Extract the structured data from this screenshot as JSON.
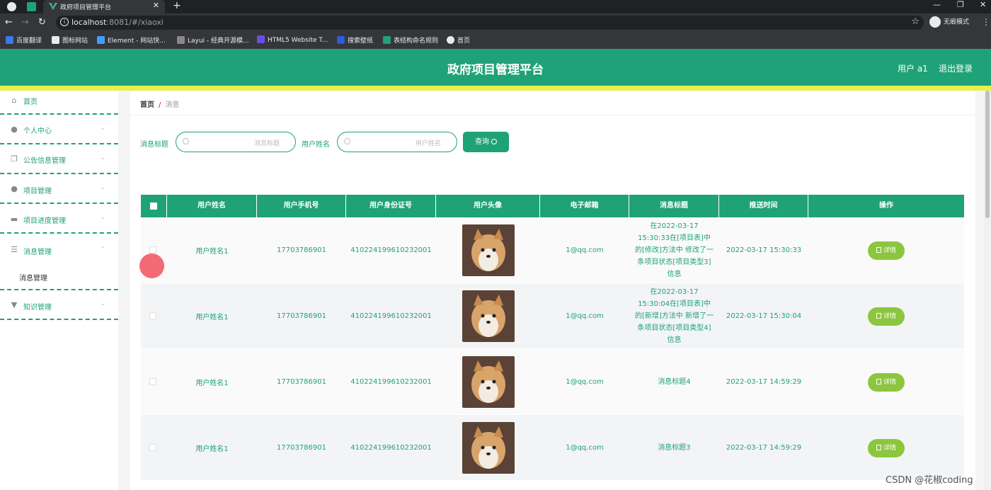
{
  "browser": {
    "tab_title": "政府项目管理平台",
    "tab_close": "✕",
    "new_tab": "+",
    "url_host": "localhost",
    "url_rest": ":8081/#/xiaoxi",
    "incognito_label": "无痕模式",
    "bookmarks": [
      {
        "label": "百度翻译",
        "color": "#3b7be8"
      },
      {
        "label": "图标网站",
        "color": "#333333"
      },
      {
        "label": "Element - 网站快...",
        "color": "#409eff"
      },
      {
        "label": "Layui - 经典开源模...",
        "color": "#888888"
      },
      {
        "label": "HTML5 Website T...",
        "color": "#6a4de2"
      },
      {
        "label": "搜索壁纸",
        "color": "#2f5bd8"
      },
      {
        "label": "表结构命名规则",
        "color": "#1fa277"
      },
      {
        "label": "首页",
        "color": "#e8eaed"
      }
    ]
  },
  "header": {
    "title": "政府项目管理平台",
    "user": "用户 a1",
    "logout": "退出登录"
  },
  "sidebar": {
    "items": [
      {
        "label": "首页",
        "icon": "home-icon",
        "glyph": "⌂"
      },
      {
        "label": "个人中心",
        "icon": "user-icon",
        "glyph": "●"
      },
      {
        "label": "公告信息管理",
        "icon": "copy-icon",
        "glyph": "❐"
      },
      {
        "label": "项目管理",
        "icon": "person-icon",
        "glyph": "●"
      },
      {
        "label": "项目进度管理",
        "icon": "briefcase-icon",
        "glyph": "▬"
      },
      {
        "label": "消息管理",
        "icon": "menu-icon",
        "glyph": "☰"
      },
      {
        "label": "知识管理",
        "icon": "pin-icon",
        "glyph": "▼"
      }
    ],
    "submenu": "消息管理"
  },
  "breadcrumb": {
    "home": "首页",
    "separator": "/",
    "current": "消息"
  },
  "search": {
    "title_label": "消息标题",
    "title_placeholder": "消息标题",
    "name_label": "用户姓名",
    "name_placeholder": "用户姓名",
    "button": "查询"
  },
  "table": {
    "columns": [
      "用户姓名",
      "用户手机号",
      "用户身份证号",
      "用户头像",
      "电子邮箱",
      "消息标题",
      "推送时间",
      "操作"
    ],
    "rows": [
      {
        "name": "用户姓名1",
        "phone": "17703786901",
        "id_card": "410224199610232001",
        "email": "1@qq.com",
        "title": "在2022-03-17 15:30:33在[项目表]中的[修改]方法中 修改了一条项目状态[项目类型3]信息",
        "time": "2022-03-17 15:30:33",
        "action": "详情"
      },
      {
        "name": "用户姓名1",
        "phone": "17703786901",
        "id_card": "410224199610232001",
        "email": "1@qq.com",
        "title": "在2022-03-17 15:30:04在[项目表]中的[新增]方法中 新增了一条项目状态[项目类型4]信息",
        "time": "2022-03-17 15:30:04",
        "action": "详情"
      },
      {
        "name": "用户姓名1",
        "phone": "17703786901",
        "id_card": "410224199610232001",
        "email": "1@qq.com",
        "title": "消息标题4",
        "time": "2022-03-17 14:59:29",
        "action": "详情"
      },
      {
        "name": "用户姓名1",
        "phone": "17703786901",
        "id_card": "410224199610232001",
        "email": "1@qq.com",
        "title": "消息标题3",
        "time": "2022-03-17 14:59:29",
        "action": "详情"
      }
    ]
  },
  "watermark": "CSDN @花椒coding",
  "colors": {
    "primary": "#1fa277",
    "accent_yellow": "#e9f04a",
    "detail_button": "#8cc63f"
  }
}
